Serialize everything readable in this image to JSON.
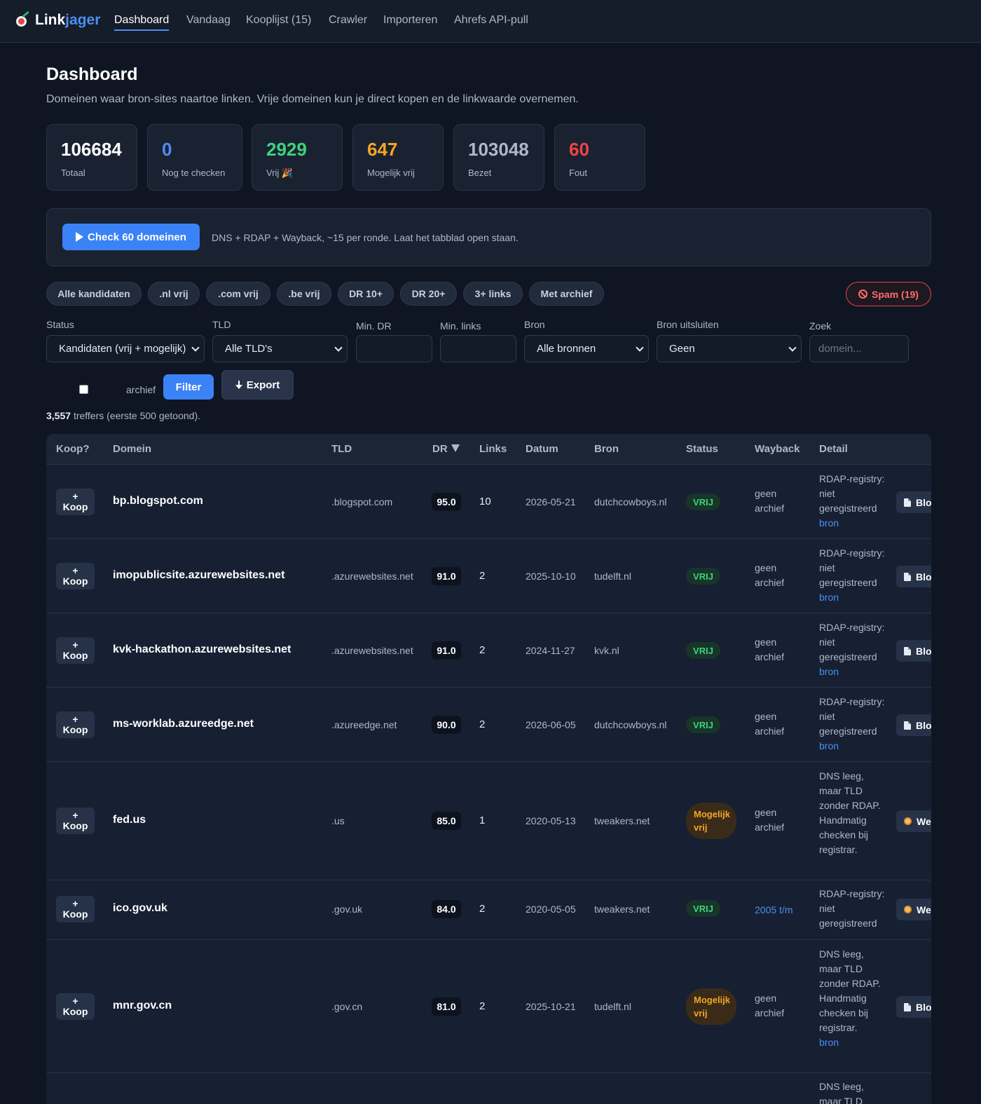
{
  "nav": {
    "brand_a": "Link",
    "brand_b": "jager",
    "links": [
      "Dashboard",
      "Vandaag",
      "Kooplijst (15)",
      "Crawler",
      "Importeren",
      "Ahrefs API-pull"
    ]
  },
  "page": {
    "title": "Dashboard",
    "subtitle": "Domeinen waar bron-sites naartoe linken. Vrije domeinen kun je direct kopen en de linkwaarde overnemen."
  },
  "stats": [
    {
      "value": "106684",
      "label": "Totaal",
      "color": "#ffffff"
    },
    {
      "value": "0",
      "label": "Nog te checken",
      "color": "#4c8ef2"
    },
    {
      "value": "2929",
      "label": "Vrij 🎉",
      "color": "#3fd17c"
    },
    {
      "value": "647",
      "label": "Mogelijk vrij",
      "color": "#f5a524"
    },
    {
      "value": "103048",
      "label": "Bezet",
      "color": "#aeb8c9"
    },
    {
      "value": "60",
      "label": "Fout",
      "color": "#ef4444"
    }
  ],
  "runner": {
    "button": "Check 60 domeinen",
    "note": "DNS + RDAP + Wayback, ~15 per ronde. Laat het tabblad open staan."
  },
  "chips": [
    "Alle kandidaten",
    ".nl vrij",
    ".com vrij",
    ".be vrij",
    "DR 10+",
    "DR 20+",
    "3+ links",
    "Met archief"
  ],
  "spam_chip": "Spam (19)",
  "filters": {
    "status_label": "Status",
    "status_value": "Kandidaten (vrij + mogelijk)",
    "tld_label": "TLD",
    "tld_value": "Alle TLD's",
    "min_dr_label": "Min. DR",
    "min_links_label": "Min. links",
    "bron_label": "Bron",
    "bron_value": "Alle bronnen",
    "bron_excl_label": "Bron uitsluiten",
    "bron_excl_value": "Geen",
    "zoek_label": "Zoek",
    "zoek_placeholder": "domein...",
    "archief_label": "archief",
    "filter_button": "Filter",
    "export_button": "Export"
  },
  "hits": {
    "count": "3,557",
    "text": "treffers (eerste 500 getoond)."
  },
  "table": {
    "headers": [
      "Koop?",
      "Domein",
      "TLD",
      "DR",
      "Links",
      "Datum",
      "Bron",
      "Status",
      "Wayback",
      "Detail"
    ],
    "koop_plus": "+",
    "koop_label": "Koop",
    "rows": [
      {
        "domain": "bp.blogspot.com",
        "tld": ".blogspot.com",
        "dr": "95.0",
        "links": "10",
        "datum": "2026-05-21",
        "bron": "dutchcowboys.nl",
        "status": "VRIJ",
        "wayback": "geen archief",
        "detail": "RDAP-registry: niet geregistreerd",
        "detail_link": "bron",
        "action": "Blo"
      },
      {
        "domain": "imopublicsite.azurewebsites.net",
        "tld": ".azurewebsites.net",
        "dr": "91.0",
        "links": "2",
        "datum": "2025-10-10",
        "bron": "tudelft.nl",
        "status": "VRIJ",
        "wayback": "geen archief",
        "detail": "RDAP-registry: niet geregistreerd",
        "detail_link": "bron",
        "action": "Blo"
      },
      {
        "domain": "kvk-hackathon.azurewebsites.net",
        "tld": ".azurewebsites.net",
        "dr": "91.0",
        "links": "2",
        "datum": "2024-11-27",
        "bron": "kvk.nl",
        "status": "VRIJ",
        "wayback": "geen archief",
        "detail": "RDAP-registry: niet geregistreerd",
        "detail_link": "bron",
        "action": "Blo"
      },
      {
        "domain": "ms-worklab.azureedge.net",
        "tld": ".azureedge.net",
        "dr": "90.0",
        "links": "2",
        "datum": "2026-06-05",
        "bron": "dutchcowboys.nl",
        "status": "VRIJ",
        "wayback": "geen archief",
        "detail": "RDAP-registry: niet geregistreerd",
        "detail_link": "bron",
        "action": "Blo"
      },
      {
        "domain": "fed.us",
        "tld": ".us",
        "dr": "85.0",
        "links": "1",
        "datum": "2020-05-13",
        "bron": "tweakers.net",
        "status": "Mogelijk vrij",
        "wayback": "geen archief",
        "detail": "DNS leeg, maar TLD zonder RDAP. Handmatig checken bij registrar.",
        "detail_link": "",
        "action": "We"
      },
      {
        "domain": "ico.gov.uk",
        "tld": ".gov.uk",
        "dr": "84.0",
        "links": "2",
        "datum": "2020-05-05",
        "bron": "tweakers.net",
        "status": "VRIJ",
        "wayback": "2005 t/m",
        "detail": "RDAP-registry: niet geregistreerd",
        "detail_link": "",
        "action": "We"
      },
      {
        "domain": "mnr.gov.cn",
        "tld": ".gov.cn",
        "dr": "81.0",
        "links": "2",
        "datum": "2025-10-21",
        "bron": "tudelft.nl",
        "status": "Mogelijk vrij",
        "wayback": "geen archief",
        "detail": "DNS leeg, maar TLD zonder RDAP. Handmatig checken bij registrar.",
        "detail_link": "bron",
        "action": "Blo"
      },
      {
        "detail": "DNS leeg, maar TLD"
      }
    ]
  }
}
